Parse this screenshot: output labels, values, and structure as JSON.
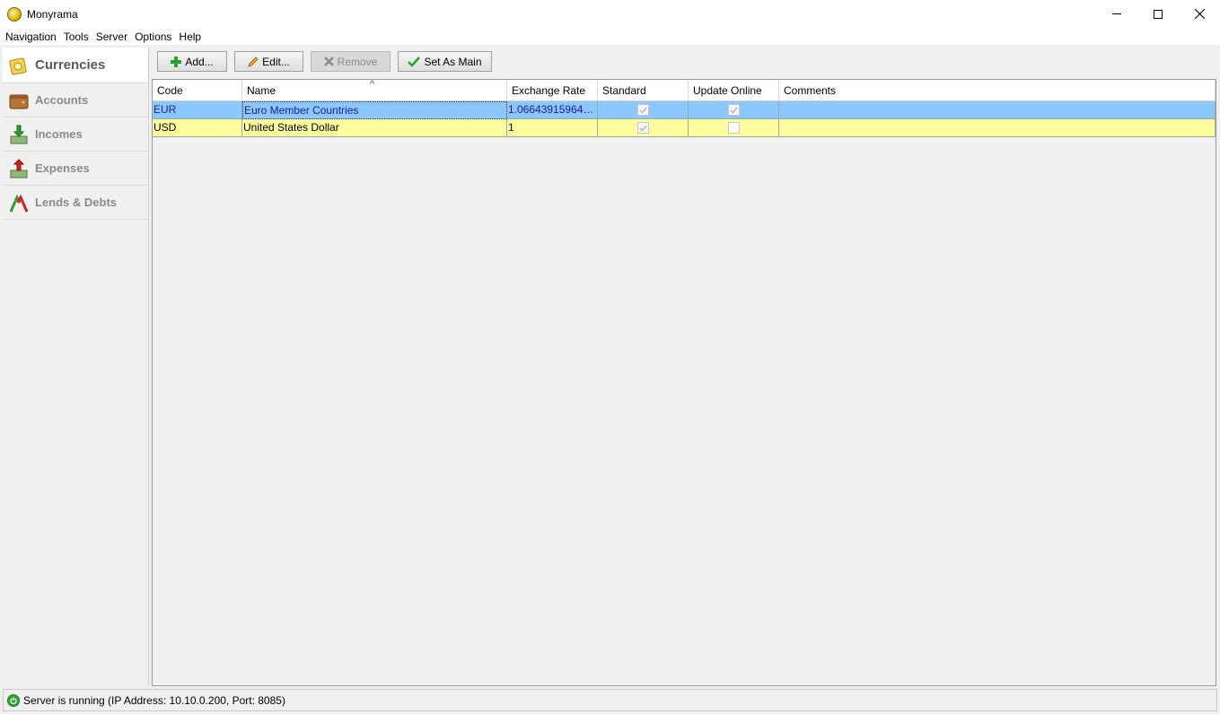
{
  "window": {
    "title": "Monyrama"
  },
  "menu": [
    "Navigation",
    "Tools",
    "Server",
    "Options",
    "Help"
  ],
  "sidebar": {
    "items": [
      {
        "label": "Currencies",
        "icon": "currencies-icon",
        "active": true
      },
      {
        "label": "Accounts",
        "icon": "wallet-icon"
      },
      {
        "label": "Incomes",
        "icon": "income-icon"
      },
      {
        "label": "Expenses",
        "icon": "expense-icon"
      },
      {
        "label": "Lends & Debts",
        "icon": "lends-debts-icon"
      }
    ]
  },
  "toolbar": {
    "add": "Add...",
    "edit": "Edit...",
    "remove": "Remove",
    "set_main": "Set As Main"
  },
  "table": {
    "columns": [
      "Code",
      "Name",
      "Exchange Rate",
      "Standard",
      "Update Online",
      "Comments"
    ],
    "rows": [
      {
        "code": "EUR",
        "name": "Euro Member Countries",
        "rate": "1.066439159645...",
        "standard": true,
        "update_online": true,
        "comments": ""
      },
      {
        "code": "USD",
        "name": "United States Dollar",
        "rate": "1",
        "standard": true,
        "update_online": false,
        "comments": ""
      }
    ]
  },
  "status": {
    "text": "Server is running (IP Address: 10.10.0.200, Port: 8085)"
  },
  "colors": {
    "selected_row": "#8ac8ff",
    "main_currency_row": "#fdfd9e",
    "status_green": "#2ea52e"
  }
}
